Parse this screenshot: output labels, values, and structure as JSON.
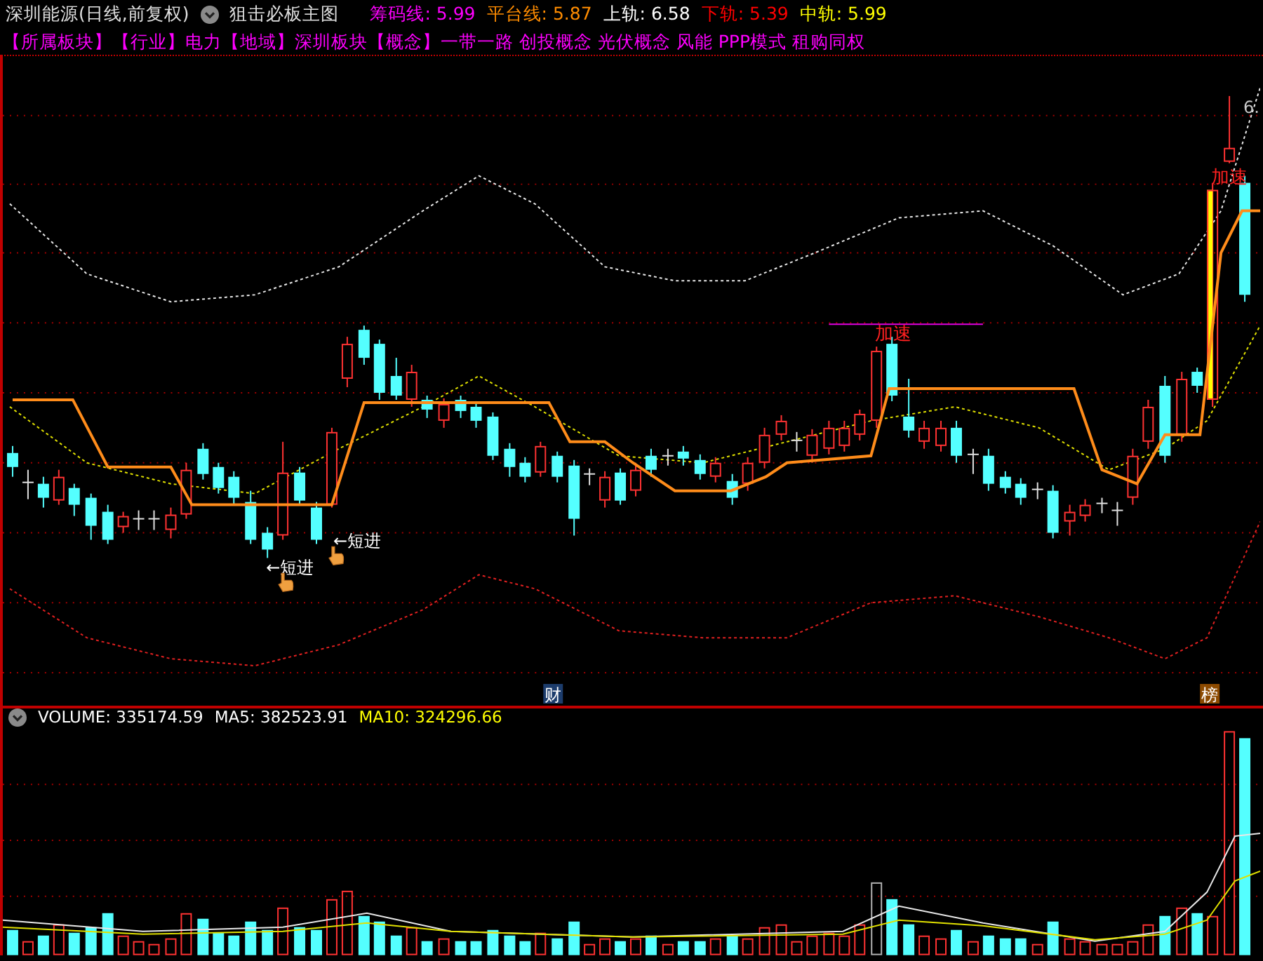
{
  "header": {
    "title": "深圳能源(日线,前复权)",
    "indicator": "狙击必板主图",
    "readings": [
      {
        "text": "筹码线: 5.99",
        "color": "#ff00ff"
      },
      {
        "text": "平台线: 5.87",
        "color": "#ff8c00"
      },
      {
        "text": "上轨: 6.58",
        "color": "#ffffff"
      },
      {
        "text": "下轨: 5.39",
        "color": "#ff0000"
      },
      {
        "text": "中轨: 5.99",
        "color": "#ffff00"
      }
    ]
  },
  "concepts": "【所属板块】【行业】电力【地域】深圳板块【概念】一带一路 创投概念 光伏概念 风能 PPP模式 租购同权",
  "chart": {
    "signals": [
      {
        "text": "加速",
        "kind": "accelerate"
      },
      {
        "text": "加速",
        "kind": "accelerate"
      },
      {
        "text": "←短进",
        "kind": "entry"
      },
      {
        "text": "←短进",
        "kind": "entry"
      }
    ],
    "price_label": "6.",
    "event_markers": [
      {
        "text": "财",
        "color": "#1c3c6c"
      },
      {
        "text": "榜",
        "color": "#8c4a00"
      }
    ]
  },
  "volume": {
    "readings": [
      {
        "text": "VOLUME: 335174.59",
        "color": "#ffffff"
      },
      {
        "text": "MA5: 382523.91",
        "color": "#ffffff"
      },
      {
        "text": "MA10: 324296.66",
        "color": "#ffff00"
      }
    ]
  }
}
